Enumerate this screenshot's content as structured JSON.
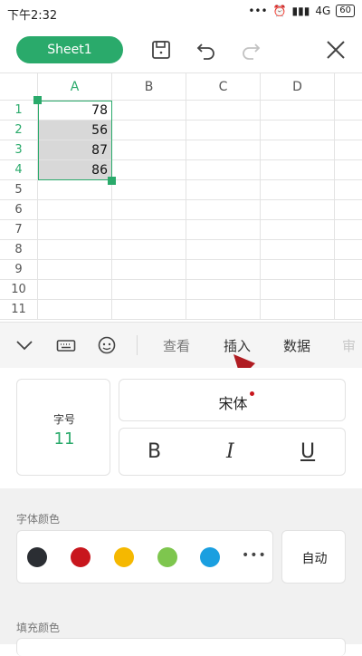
{
  "status": {
    "time": "下午2:32",
    "network": "4G",
    "battery": "60"
  },
  "toolbar": {
    "sheet_tab": "Sheet1"
  },
  "grid": {
    "columns": [
      "A",
      "B",
      "C",
      "D"
    ],
    "rows": [
      "1",
      "2",
      "3",
      "4",
      "5",
      "6",
      "7",
      "8",
      "9",
      "10",
      "11"
    ],
    "column_a_values": [
      "78",
      "56",
      "87",
      "86"
    ]
  },
  "strip": {
    "tabs": [
      "查看",
      "插入",
      "数据",
      "审"
    ]
  },
  "font_panel": {
    "size_label": "字号",
    "size_value": "11",
    "font_name": "宋体",
    "bold": "B",
    "italic": "I",
    "underline": "U",
    "font_color_label": "字体颜色",
    "auto_label": "自动",
    "more_label": "•••",
    "fill_color_label": "填充颜色",
    "colors": [
      "#2b2e33",
      "#c8161d",
      "#f5b800",
      "#7ec64e",
      "#1a9fe0"
    ]
  }
}
